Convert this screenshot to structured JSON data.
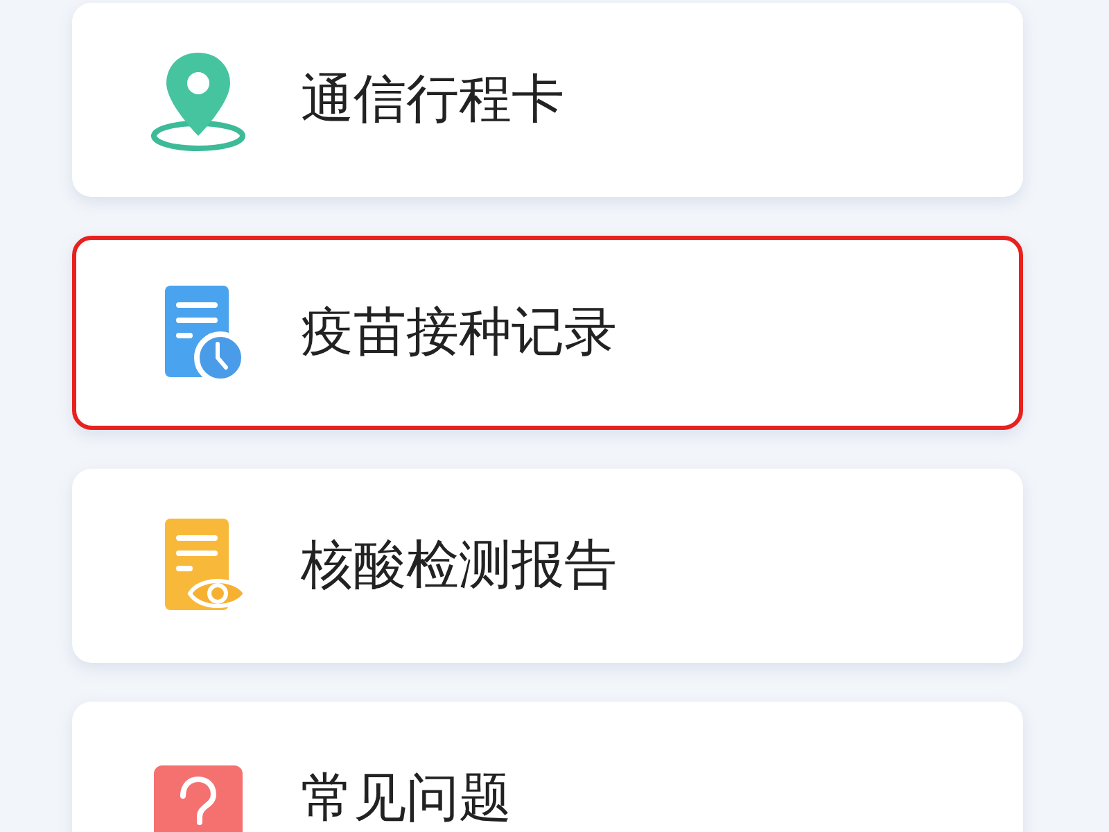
{
  "items": [
    {
      "label": "通信行程卡",
      "kind": "pin",
      "highlighted": false
    },
    {
      "label": "疫苗接种记录",
      "kind": "clock",
      "highlighted": true
    },
    {
      "label": "核酸检测报告",
      "kind": "eye",
      "highlighted": false
    },
    {
      "label": "常见问题",
      "kind": "help",
      "highlighted": false
    }
  ]
}
